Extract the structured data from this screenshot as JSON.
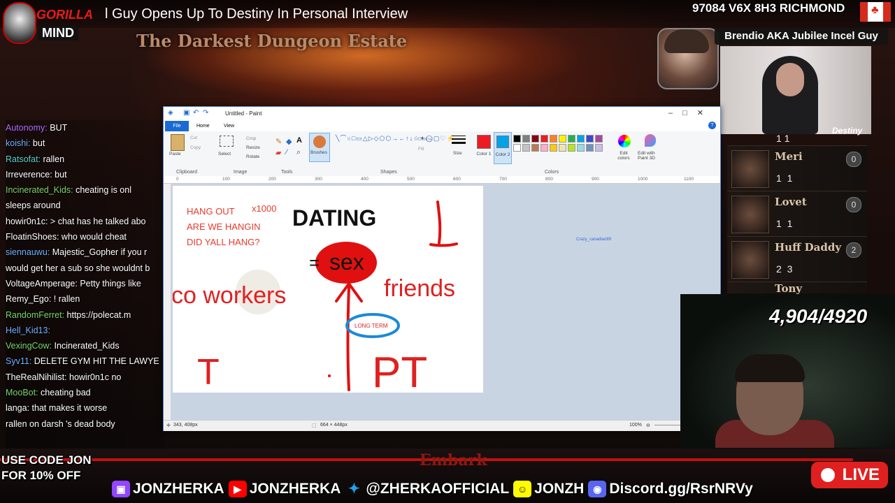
{
  "stream": {
    "title": "l Guy Opens Up To Destiny In Personal Interview",
    "game_title": "The Darkest Dungeon Estate",
    "address": "97084 V6X 8H3 RICHMOND",
    "logo_word1": "GORILLA",
    "logo_word2": "MIND",
    "guest_banner": "Brendio AKA Jubilee Incel Guy",
    "destiny_tag": "Destiny",
    "counter": "4,904/4920",
    "live_label": "LIVE",
    "embark": "Embark",
    "promo_line1": "USE CODE JON",
    "promo_line2": "FOR 10% OFF",
    "colors": {
      "accent_red": "#e51c1c",
      "live_red": "#e02020",
      "paint_blue": "#1a6ad4"
    }
  },
  "socials": [
    {
      "icon": "twitch-icon",
      "label": "JONZHERKA"
    },
    {
      "icon": "youtube-icon",
      "label": "JONZHERKA"
    },
    {
      "icon": "twitter-icon",
      "label": "@ZHERKAOFFICIAL"
    },
    {
      "icon": "snapchat-icon",
      "label": "JONZH"
    },
    {
      "icon": "discord-icon",
      "label": "Discord.gg/RsrNRVy"
    }
  ],
  "heroes": {
    "first_stats": "1     1",
    "items": [
      {
        "name": "Meri",
        "stats": "1    1",
        "level": "0"
      },
      {
        "name": "Lovet",
        "stats": "1    1",
        "level": "0"
      },
      {
        "name": "Huff Daddy",
        "stats": "2    3",
        "level": "2"
      },
      {
        "name": "Tony",
        "stats": "",
        "level": ""
      }
    ]
  },
  "chat": [
    {
      "user": "Autonomy:",
      "color": "#b36bff",
      "text": " BUT"
    },
    {
      "user": "koishi:",
      "color": "#6fb0ff",
      "text": " but"
    },
    {
      "user": "Ratsofat:",
      "color": "#5ad1c8",
      "text": " rallen"
    },
    {
      "user": "Irreverence:",
      "color": "#ffffff",
      "text": " but"
    },
    {
      "user": "Incinerated_Kids:",
      "color": "#7bd36b",
      "text": " cheating is onl"
    },
    {
      "user": "",
      "color": "#ffffff",
      "text": "sleeps around"
    },
    {
      "user": "howir0n1c:",
      "color": "#ffffff",
      "text": " > chat has he talked abo"
    },
    {
      "user": "FloatinShoes:",
      "color": "#ffffff",
      "text": " who would cheat"
    },
    {
      "user": "siennauwu:",
      "color": "#6fb0ff",
      "text": " Majestic_Gopher if you r"
    },
    {
      "user": "",
      "color": "#ffffff",
      "text": "would get her a sub so she wouldnt b"
    },
    {
      "user": "VoltageAmperage:",
      "color": "#ffffff",
      "text": " Petty things like"
    },
    {
      "user": "Remy_Ego:",
      "color": "#ffffff",
      "text": " ! rallen"
    },
    {
      "user": "RandomFerret:",
      "color": "#7bd36b",
      "text": " https://polecat.m"
    },
    {
      "user": "",
      "color": "#ffffff",
      "text": ""
    },
    {
      "user": "Hell_Kid13:",
      "color": "#6fb0ff",
      "text": ""
    },
    {
      "user": "VexingCow:",
      "color": "#7bd36b",
      "text": " Incinerated_Kids"
    },
    {
      "user": "Syv11:",
      "color": "#6fb0ff",
      "text": " DELETE GYM HIT THE LAWYE"
    },
    {
      "user": "TheRealNihilist:",
      "color": "#ffffff",
      "text": " howir0n1c no"
    },
    {
      "user": "MooBot:",
      "color": "#7bd36b",
      "text": " cheating bad"
    },
    {
      "user": "",
      "color": "#ffffff",
      "text": "langa: that makes it worse"
    },
    {
      "user": "rallen",
      "color": "#ffffff",
      "text": "       on darsh 's dead body"
    }
  ],
  "paint": {
    "window_title": "Untitled - Paint",
    "tabs": [
      "File",
      "Home",
      "View"
    ],
    "groups": [
      "Clipboard",
      "Image",
      "Tools",
      "Shapes",
      "Colors"
    ],
    "labels": {
      "paste": "Paste",
      "cut": "Cut",
      "copy": "Copy",
      "select": "Select",
      "crop": "Crop",
      "resize": "Resize",
      "rotate": "Rotate",
      "brushes": "Brushes",
      "outline": "Outline",
      "fill": "Fill",
      "size": "Size",
      "color1": "Color 1",
      "color2": "Color 2",
      "edit_colors": "Edit colors",
      "edit_3d": "Edit with Paint 3D"
    },
    "palette": [
      "#000000",
      "#7f7f7f",
      "#880015",
      "#ed1c24",
      "#ff7f27",
      "#fff200",
      "#22b14c",
      "#00a2e8",
      "#3f48cc",
      "#a349a4",
      "#ffffff",
      "#c3c3c3",
      "#b97a57",
      "#ffaec9",
      "#ffc90e",
      "#efe4b0",
      "#b5e61d",
      "#99d9ea",
      "#7092be",
      "#c8bfe7"
    ],
    "color1": "#ed1c24",
    "color2": "#00a2e8",
    "ruler": [
      "0",
      "100",
      "200",
      "300",
      "400",
      "500",
      "600",
      "700",
      "800",
      "900",
      "1000",
      "1100"
    ],
    "cursor_pos": "343, 408px",
    "canvas_size": "664 × 448px",
    "zoom": "100%",
    "overlay_user": "Crazy_canadian89",
    "drawing": {
      "hang_lines": [
        "HANG OUT",
        "ARE WE HANGIN",
        "DID YALL HANG?"
      ],
      "x1000": "x1000",
      "dating": "DATING",
      "equals": "=",
      "sex": "sex",
      "coworkers": "co workers",
      "friends": "friends",
      "longterm": "LONG TERM",
      "t": "T",
      "pt": "PT"
    }
  }
}
